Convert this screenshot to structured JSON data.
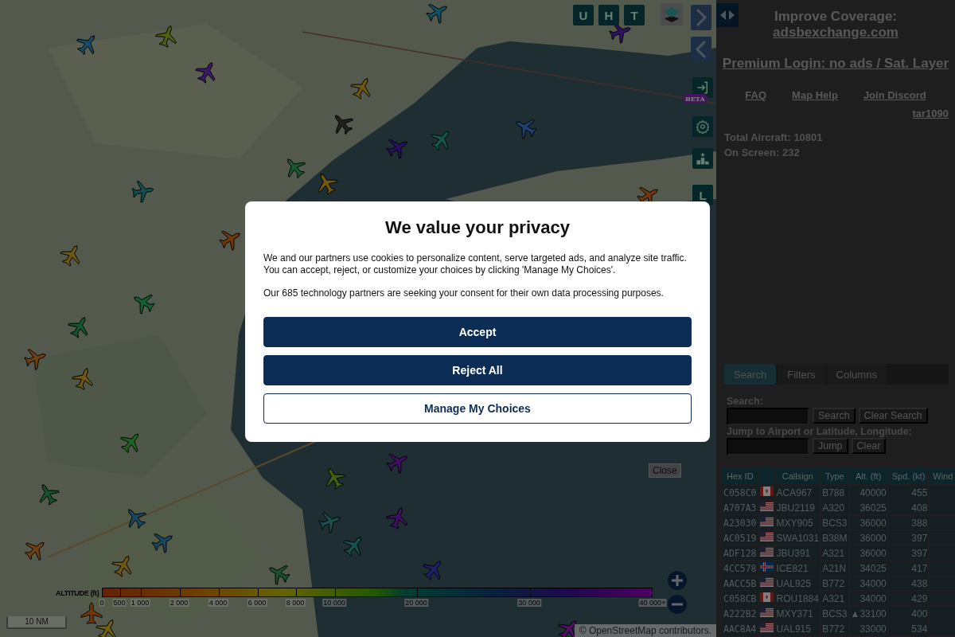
{
  "map": {
    "mode_buttons": [
      {
        "label": "U"
      },
      {
        "label": "H"
      },
      {
        "label": "T"
      }
    ],
    "side_buttons": [
      {
        "kind": "login",
        "badge": "BETA"
      },
      {
        "kind": "settings"
      },
      {
        "kind": "podium"
      },
      {
        "kind": "letter",
        "label": "L"
      }
    ],
    "close_button": "Close",
    "altitude_legend": {
      "title": "ALTITUDE (ft)",
      "ticks": [
        "0",
        "500",
        "1 000",
        "2 000",
        "4 000",
        "6 000",
        "8 000",
        "10 000",
        "20 000",
        "30 000",
        "40 000+"
      ]
    },
    "scale": "10 NM",
    "attribution": "© OpenStreetMap contributors."
  },
  "sidebar": {
    "coverage_label": "Improve Coverage:",
    "coverage_link": "adsbexchange.com",
    "premium_link": "Premium Login: no ads / Sat. Layer",
    "links": [
      "FAQ",
      "Map Help",
      "Join Discord"
    ],
    "version_link": "tar1090",
    "stats": [
      "Total Aircraft: 10801",
      "On Screen: 232"
    ],
    "tabs": [
      {
        "label": "Search",
        "selected": true
      },
      {
        "label": "Filters",
        "selected": false
      },
      {
        "label": "Columns",
        "selected": false
      }
    ],
    "search_label": "Search:",
    "search_buttons": [
      "Search",
      "Clear Search"
    ],
    "jump_label": "Jump to Airport or Latitude, Longitude:",
    "jump_buttons": [
      "Jump",
      "Clear"
    ],
    "table": {
      "columns": [
        "Hex ID",
        "",
        "Callsign",
        "Type",
        "Alt. (ft)",
        "Spd. (kt)",
        "Wind"
      ],
      "rows": [
        {
          "hex": "C058C0",
          "kind": "canada",
          "callsign": "ACA967",
          "type": "B788",
          "alt": "40000",
          "speed": "455"
        },
        {
          "hex": "A707A3",
          "kind": "usa",
          "callsign": "JBU2119",
          "type": "A320",
          "alt": "36025",
          "speed": "408"
        },
        {
          "hex": "A23030",
          "kind": "usa",
          "callsign": "MXY905",
          "type": "BCS3",
          "alt": "36000",
          "speed": "388"
        },
        {
          "hex": "AC0519",
          "kind": "usa",
          "callsign": "SWA1031",
          "type": "B38M",
          "alt": "36000",
          "speed": "397"
        },
        {
          "hex": "ADF128",
          "kind": "usa",
          "callsign": "JBU391",
          "type": "A321",
          "alt": "36000",
          "speed": "397"
        },
        {
          "hex": "4CC578",
          "kind": "iceland",
          "callsign": "ICE821",
          "type": "A21N",
          "alt": "34025",
          "speed": "417"
        },
        {
          "hex": "AACC5B",
          "kind": "usa",
          "callsign": "UAL925",
          "type": "B772",
          "alt": "34000",
          "speed": "438"
        },
        {
          "hex": "C058CB",
          "kind": "canada",
          "callsign": "ROU1884",
          "type": "A321",
          "alt": "34000",
          "speed": "429"
        },
        {
          "hex": "A222B2",
          "kind": "usa",
          "callsign": "MXY371",
          "type": "BCS3",
          "alt": "▲33100",
          "speed": "400"
        },
        {
          "hex": "AAC8A4",
          "kind": "usa",
          "callsign": "UAL915",
          "type": "B772",
          "alt": "33000",
          "speed": "534"
        }
      ]
    }
  },
  "dialog": {
    "title": "We value your privacy",
    "paragraphs": [
      "We and our partners use cookies to personalize content, serve targeted ads, and analyze site traffic. You can accept, reject, or customize your choices by clicking 'Manage My Choices'.",
      "Our 685 technology partners are seeking your consent for their own data processing purposes."
    ],
    "buttons": [
      {
        "label": "Accept",
        "kind": "primary"
      },
      {
        "label": "Reject All",
        "kind": "primary"
      },
      {
        "label": "Manage My Choices",
        "kind": "outline"
      }
    ]
  }
}
